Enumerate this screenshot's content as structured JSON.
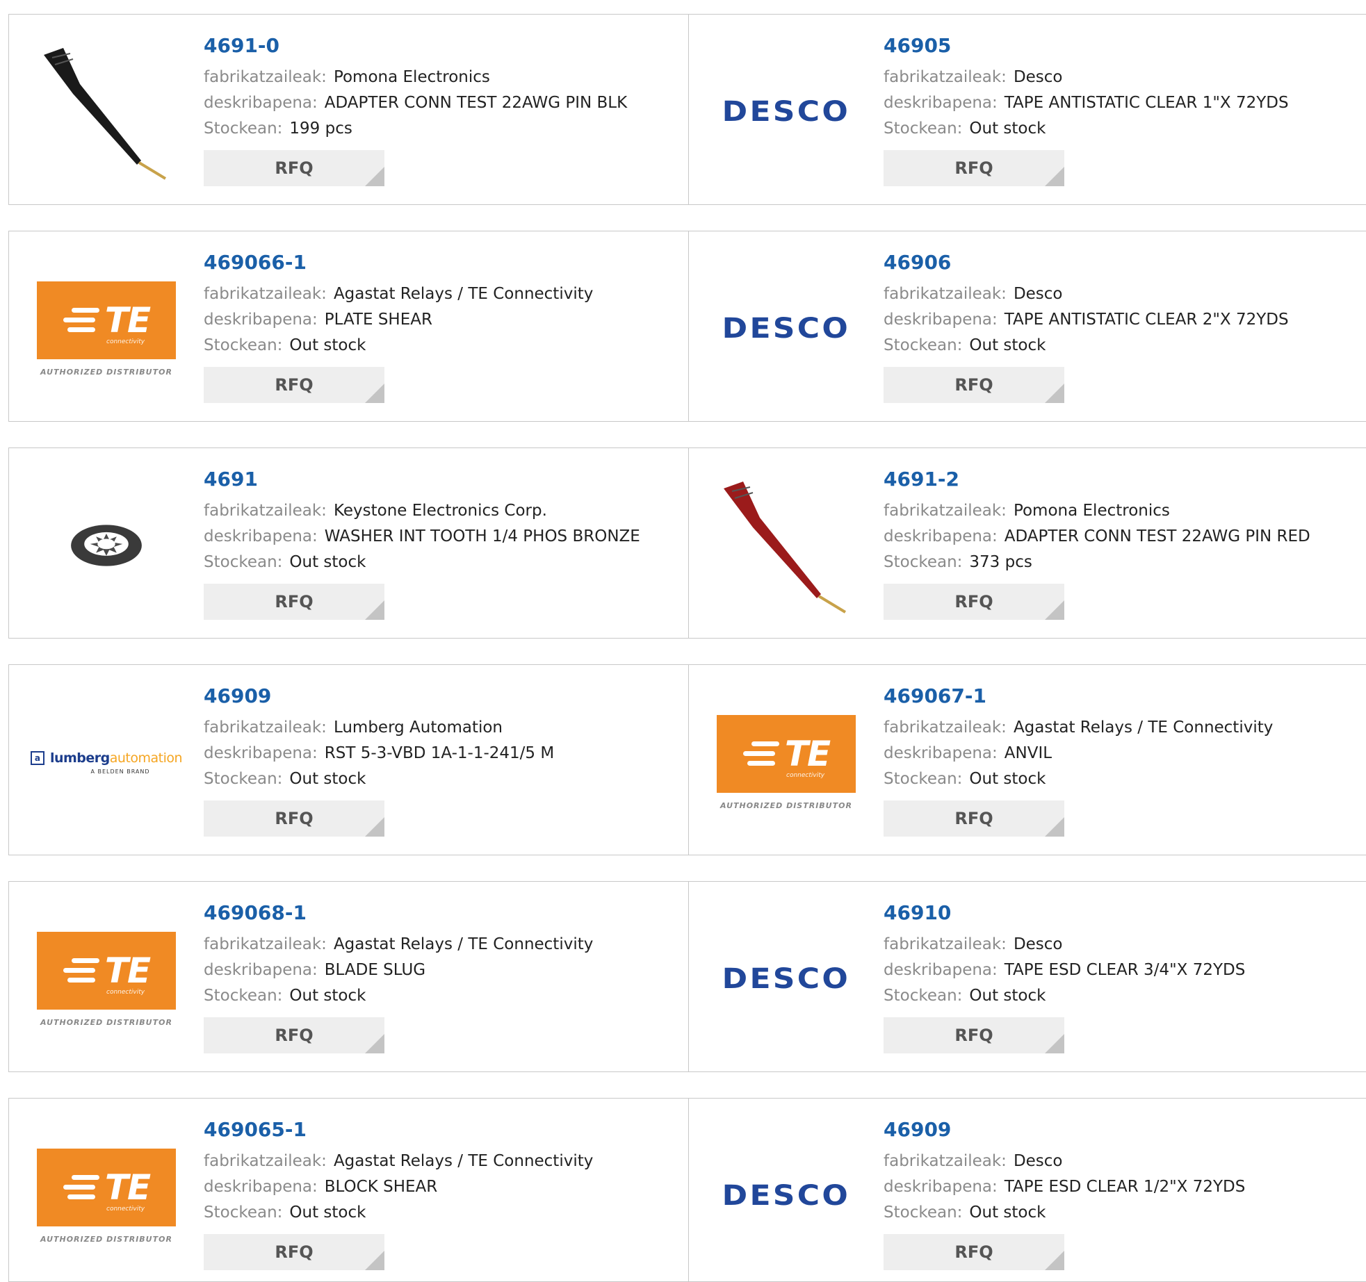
{
  "labels": {
    "manufacturer": "fabrikatzaileak:",
    "description": "deskribapena:",
    "stock": "Stockean:",
    "rfq": "RFQ"
  },
  "products": [
    {
      "part": "4691-0",
      "manufacturer": "Pomona Electronics",
      "description": "ADAPTER CONN TEST 22AWG PIN BLK",
      "stock": "199 pcs",
      "image": "black-test-probe"
    },
    {
      "part": "46905",
      "manufacturer": "Desco",
      "description": "TAPE ANTISTATIC CLEAR 1\"X 72YDS",
      "stock": "Out stock",
      "image": "desco-logo"
    },
    {
      "part": "469066-1",
      "manufacturer": "Agastat Relays / TE Connectivity",
      "description": "PLATE SHEAR",
      "stock": "Out stock",
      "image": "te-logo"
    },
    {
      "part": "46906",
      "manufacturer": "Desco",
      "description": "TAPE ANTISTATIC CLEAR 2\"X 72YDS",
      "stock": "Out stock",
      "image": "desco-logo"
    },
    {
      "part": "4691",
      "manufacturer": "Keystone Electronics Corp.",
      "description": "WASHER INT TOOTH 1/4 PHOS BRONZE",
      "stock": "Out stock",
      "image": "washer"
    },
    {
      "part": "4691-2",
      "manufacturer": "Pomona Electronics",
      "description": "ADAPTER CONN TEST 22AWG PIN RED",
      "stock": "373 pcs",
      "image": "red-test-probe"
    },
    {
      "part": "46909",
      "manufacturer": "Lumberg Automation",
      "description": "RST 5-3-VBD 1A-1-1-241/5 M",
      "stock": "Out stock",
      "image": "lumberg-logo"
    },
    {
      "part": "469067-1",
      "manufacturer": "Agastat Relays / TE Connectivity",
      "description": "ANVIL",
      "stock": "Out stock",
      "image": "te-logo"
    },
    {
      "part": "469068-1",
      "manufacturer": "Agastat Relays / TE Connectivity",
      "description": "BLADE SLUG",
      "stock": "Out stock",
      "image": "te-logo"
    },
    {
      "part": "46910",
      "manufacturer": "Desco",
      "description": "TAPE ESD CLEAR 3/4\"X 72YDS",
      "stock": "Out stock",
      "image": "desco-logo"
    },
    {
      "part": "469065-1",
      "manufacturer": "Agastat Relays / TE Connectivity",
      "description": "BLOCK SHEAR",
      "stock": "Out stock",
      "image": "te-logo"
    },
    {
      "part": "46909",
      "manufacturer": "Desco",
      "description": "TAPE ESD CLEAR 1/2\"X 72YDS",
      "stock": "Out stock",
      "image": "desco-logo"
    }
  ],
  "logos": {
    "desco": "DESCO",
    "te": "TE",
    "te_sub": "connectivity",
    "te_distributor": "AUTHORIZED DISTRIBUTOR",
    "lumberg_a": "lumberg",
    "lumberg_b": "automation",
    "lumberg_sub": "A BELDEN BRAND"
  },
  "colors": {
    "link": "#1a5fa8",
    "label": "#8a8a8a",
    "te_orange": "#f08a24",
    "desco_blue": "#21479a"
  }
}
